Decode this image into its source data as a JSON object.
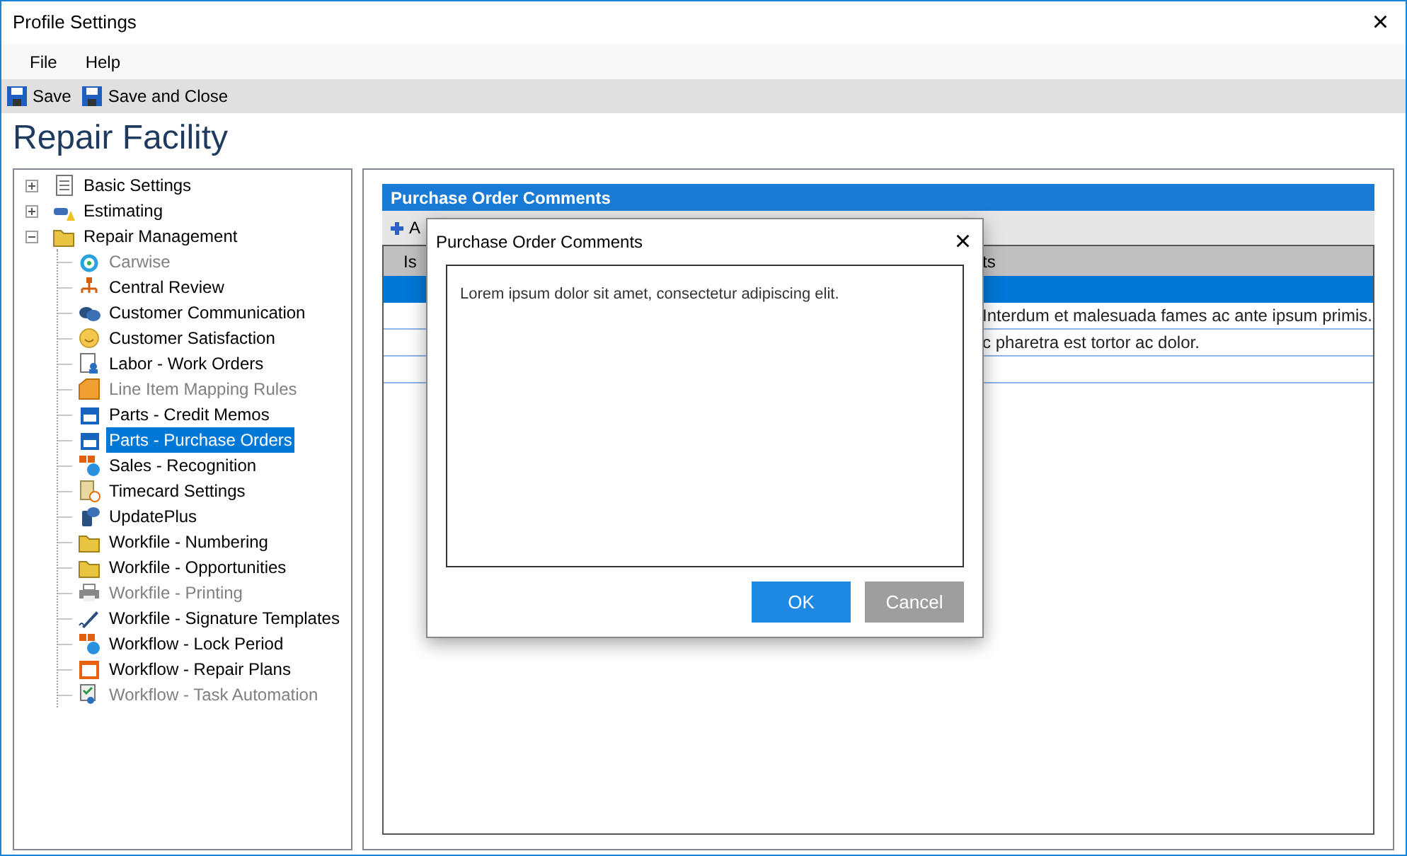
{
  "window": {
    "title": "Profile Settings",
    "close": "×"
  },
  "menu": [
    "File",
    "Help"
  ],
  "toolbar": [
    "Save",
    "Save and Close"
  ],
  "heading": "Repair Facility",
  "tree": [
    {
      "label": "Basic Settings",
      "expanded": false,
      "disabled": false,
      "selected": false
    },
    {
      "label": "Estimating",
      "expanded": false,
      "disabled": false,
      "selected": false
    },
    {
      "label": "Repair Management",
      "expanded": true,
      "disabled": false,
      "selected": false,
      "children": [
        {
          "label": "Carwise",
          "disabled": true,
          "selected": false
        },
        {
          "label": "Central Review",
          "disabled": false,
          "selected": false
        },
        {
          "label": "Customer Communication",
          "disabled": false,
          "selected": false
        },
        {
          "label": "Customer Satisfaction",
          "disabled": false,
          "selected": false
        },
        {
          "label": "Labor - Work Orders",
          "disabled": false,
          "selected": false
        },
        {
          "label": "Line Item Mapping Rules",
          "disabled": true,
          "selected": false
        },
        {
          "label": "Parts - Credit Memos",
          "disabled": false,
          "selected": false
        },
        {
          "label": "Parts - Purchase Orders",
          "disabled": false,
          "selected": true
        },
        {
          "label": "Sales - Recognition",
          "disabled": false,
          "selected": false
        },
        {
          "label": "Timecard Settings",
          "disabled": false,
          "selected": false
        },
        {
          "label": "UpdatePlus",
          "disabled": false,
          "selected": false
        },
        {
          "label": "Workfile - Numbering",
          "disabled": false,
          "selected": false
        },
        {
          "label": "Workfile - Opportunities",
          "disabled": false,
          "selected": false
        },
        {
          "label": "Workfile - Printing",
          "disabled": true,
          "selected": false
        },
        {
          "label": "Workfile - Signature Templates",
          "disabled": false,
          "selected": false
        },
        {
          "label": "Workflow - Lock Period",
          "disabled": false,
          "selected": false
        },
        {
          "label": "Workflow - Repair Plans",
          "disabled": false,
          "selected": false
        },
        {
          "label": "Workflow - Task Automation",
          "disabled": true,
          "selected": false
        }
      ]
    }
  ],
  "panel": {
    "title": "Purchase Order Comments",
    "add_button": "A",
    "columns": [
      "Is",
      "ts"
    ],
    "rows": [
      {
        "column_2": "",
        "selected": true
      },
      {
        "column_2": "Interdum et malesuada fames ac ante ipsum primis.",
        "selected": false
      },
      {
        "column_2": "c pharetra est tortor ac dolor.",
        "selected": false
      },
      {
        "column_2": "",
        "selected": false
      }
    ]
  },
  "dialog": {
    "title": "Purchase Order Comments",
    "close": "×",
    "comment": "Lorem ipsum dolor sit amet, consectetur adipiscing elit.",
    "buttons": [
      "OK",
      "Cancel"
    ]
  }
}
